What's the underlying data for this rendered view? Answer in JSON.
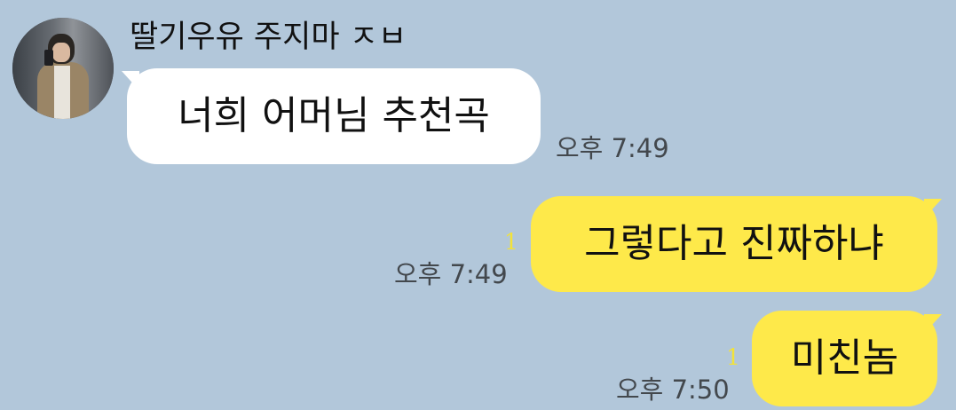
{
  "chat": {
    "sender": {
      "name": "딸기우유 주지마 ㅈㅂ",
      "avatar": "profile-photo"
    },
    "messages": [
      {
        "side": "incoming",
        "text": "너희 어머님 추천곡",
        "time": "오후 7:49",
        "unread": ""
      },
      {
        "side": "outgoing",
        "text": "그렇다고 진짜하냐",
        "time": "오후 7:49",
        "unread": "1"
      },
      {
        "side": "outgoing",
        "text": "미친놈",
        "time": "오후 7:50",
        "unread": "1"
      }
    ]
  },
  "colors": {
    "background": "#b2c7da",
    "incoming_bubble": "#ffffff",
    "outgoing_bubble": "#fee94a",
    "unread_count": "#f2e23a"
  }
}
